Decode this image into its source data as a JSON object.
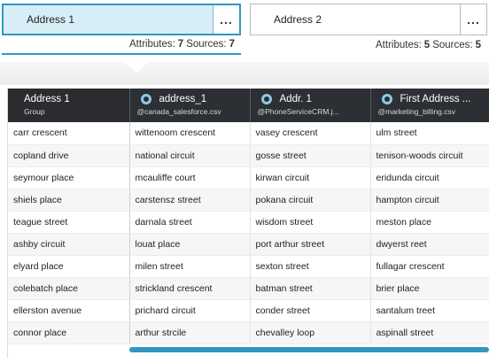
{
  "cards": [
    {
      "title": "Address 1",
      "more": "...",
      "attr_label": "Attributes:",
      "attr_count": "7",
      "src_label": "Sources:",
      "src_count": "7"
    },
    {
      "title": "Address 2",
      "more": "...",
      "attr_label": "Attributes:",
      "attr_count": "5",
      "src_label": "Sources:",
      "src_count": "5"
    }
  ],
  "grid": {
    "columns": [
      {
        "title": "Address 1",
        "subtitle": "Group"
      },
      {
        "title": "address_1",
        "subtitle": "@canada_salesforce.csv",
        "icon": "source-icon"
      },
      {
        "title": "Addr. 1",
        "subtitle": "@PhoneServiceCRM.j...",
        "icon": "source-icon"
      },
      {
        "title": "First Address ...",
        "subtitle": "@marketing_billing.csv",
        "icon": "source-icon"
      }
    ],
    "rows": [
      [
        "carr crescent",
        "wittenoom crescent",
        "vasey crescent",
        "ulm street"
      ],
      [
        "copland drive",
        "national circuit",
        "gosse street",
        "tenison-woods circuit"
      ],
      [
        "seymour place",
        "mcauliffe court",
        "kirwan circuit",
        "eridunda circuit"
      ],
      [
        "shiels place",
        "carstensz street",
        "pokana circuit",
        "hampton circuit"
      ],
      [
        "teague street",
        "darnala street",
        "wisdom street",
        "meston place"
      ],
      [
        "ashby circuit",
        "louat place",
        "port arthur street",
        "dwyerst reet"
      ],
      [
        "elyard place",
        "milen street",
        "sexton street",
        "fullagar crescent"
      ],
      [
        "colebatch place",
        "strickland crescent",
        "batman street",
        "brier place"
      ],
      [
        "ellerston avenue",
        "prichard circuit",
        "conder street",
        "santalum treet"
      ],
      [
        "connor place",
        "arthur strcile",
        "chevalley loop",
        "aspinall street"
      ]
    ]
  },
  "colors": {
    "accent": "#2f97c1",
    "header_bg": "#2c2f33",
    "selected_card_bg": "#d8eef7"
  }
}
